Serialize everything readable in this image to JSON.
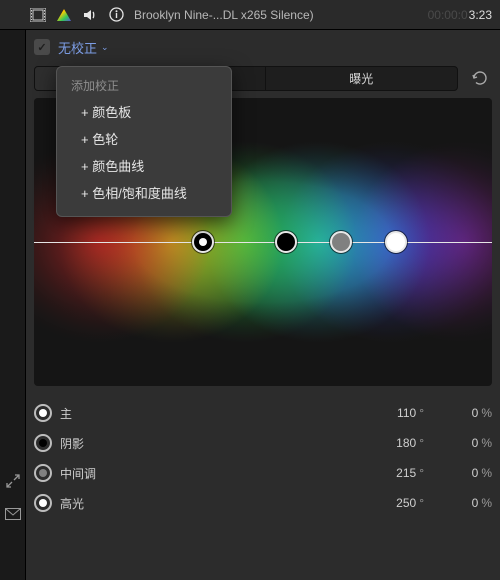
{
  "topbar": {
    "title": "Brooklyn Nine-...DL x265 Silence)",
    "timecode_dim": "00:00:0",
    "timecode_bright": "3:23"
  },
  "header": {
    "correction_label": "无校正"
  },
  "tabs": {
    "hidden1": "",
    "hidden2": "",
    "exposure": "曝光"
  },
  "popover": {
    "title": "添加校正",
    "items": [
      "+ 颜色板",
      "+ 色轮",
      "+ 颜色曲线",
      "+ 色相/饱和度曲线"
    ]
  },
  "params": [
    {
      "key": "master",
      "label": "主",
      "angle": "110",
      "pct": "0",
      "dot": "#ffffff"
    },
    {
      "key": "shadows",
      "label": "阴影",
      "angle": "180",
      "pct": "0",
      "dot": "#000000"
    },
    {
      "key": "midtones",
      "label": "中间调",
      "angle": "215",
      "pct": "0",
      "dot": "#808080"
    },
    {
      "key": "highlights",
      "label": "高光",
      "angle": "250",
      "pct": "0",
      "dot": "#ffffff"
    }
  ],
  "units": {
    "deg": "°",
    "pct": "%"
  }
}
